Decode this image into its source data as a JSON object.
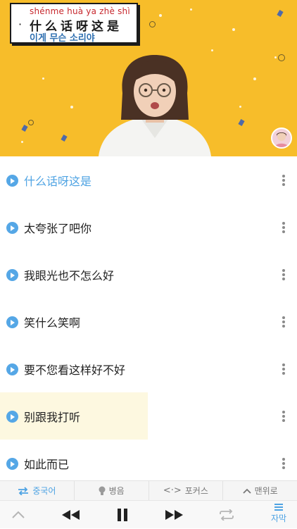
{
  "video": {
    "caption": {
      "pinyin": "shénme huà ya zhè shì",
      "hanzi": "什么话呀这是",
      "korean": "이게 무슨 소리야"
    }
  },
  "sentences": [
    {
      "text": "什么话呀这是",
      "active": true
    },
    {
      "text": "太夸张了吧你",
      "active": false
    },
    {
      "text": "我眼光也不怎么好",
      "active": false
    },
    {
      "text": "笑什么笑啊",
      "active": false
    },
    {
      "text": "要不您看这样好不好",
      "active": false
    },
    {
      "text": "别跟我打听",
      "active": false,
      "highlighted": true
    },
    {
      "text": "如此而已",
      "active": false
    }
  ],
  "toolbar_top": {
    "language": "중국어",
    "pinyin": "병음",
    "focus": "포커스",
    "to_top": "맨위로"
  },
  "toolbar_bottom": {
    "subtitle": "자막"
  },
  "icons": {
    "language": "swap-arrows-icon",
    "pinyin": "lightbulb-icon",
    "focus": "code-arrows-icon",
    "to_top": "chevron-up-icon",
    "collapse": "chevron-up-icon",
    "rewind": "rewind-icon",
    "pause": "pause-icon",
    "forward": "fast-forward-icon",
    "repeat": "repeat-icon",
    "subtitle": "subtitle-lines-icon"
  },
  "colors": {
    "video_bg": "#f7bd2a",
    "accent": "#4ea3e3",
    "pinyin_red": "#c7282e",
    "korean_blue": "#2e6fb0",
    "highlight_bg": "#fdf8e0"
  }
}
